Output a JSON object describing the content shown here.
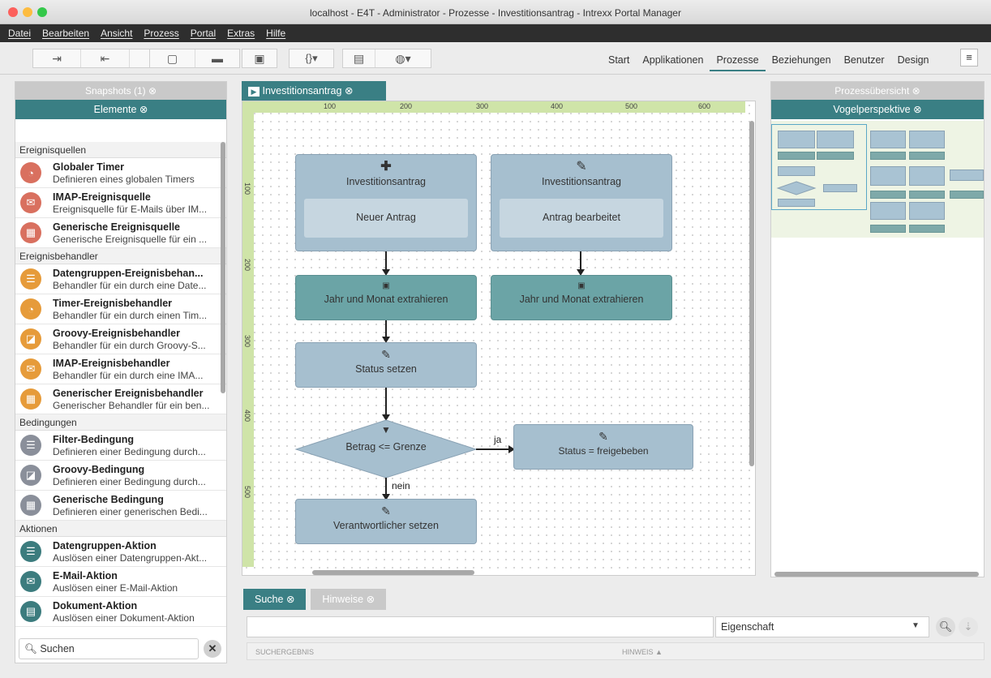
{
  "window": {
    "title": "localhost - E4T - Administrator - Prozesse - Investitionsantrag - Intrexx Portal Manager"
  },
  "menu": [
    "Datei",
    "Bearbeiten",
    "Ansicht",
    "Prozess",
    "Portal",
    "Extras",
    "Hilfe"
  ],
  "toolbar": {
    "nav": [
      "Start",
      "Applikationen",
      "Prozesse",
      "Beziehungen",
      "Benutzer",
      "Design"
    ],
    "active": "Prozesse"
  },
  "left": {
    "snapshots": "Snapshots (1)",
    "elements": "Elemente",
    "categories": [
      {
        "name": "Ereignisquellen",
        "items": [
          {
            "title": "Globaler Timer",
            "desc": "Definieren eines globalen Timers",
            "icon": "timer-icon",
            "color": "red"
          },
          {
            "title": "IMAP-Ereignisquelle",
            "desc": "Ereignisquelle für E-Mails über IM...",
            "icon": "mail-icon",
            "color": "red"
          },
          {
            "title": "Generische Ereignisquelle",
            "desc": "Generische Ereignisquelle für ein ...",
            "icon": "generic-icon",
            "color": "red"
          }
        ]
      },
      {
        "name": "Ereignisbehandler",
        "items": [
          {
            "title": "Datengruppen-Ereignisbehan...",
            "desc": "Behandler für ein durch eine Date...",
            "icon": "database-icon",
            "color": "org"
          },
          {
            "title": "Timer-Ereignisbehandler",
            "desc": "Behandler für ein durch einen Tim...",
            "icon": "timer-icon",
            "color": "org"
          },
          {
            "title": "Groovy-Ereignisbehandler",
            "desc": "Behandler für ein durch Groovy-S...",
            "icon": "groovy-icon",
            "color": "org"
          },
          {
            "title": "IMAP-Ereignisbehandler",
            "desc": "Behandler für ein durch eine IMA...",
            "icon": "mail-icon",
            "color": "org"
          },
          {
            "title": "Generischer Ereignisbehandler",
            "desc": "Generischer Behandler für ein ben...",
            "icon": "generic-icon",
            "color": "org"
          }
        ]
      },
      {
        "name": "Bedingungen",
        "items": [
          {
            "title": "Filter-Bedingung",
            "desc": "Definieren einer Bedingung durch...",
            "icon": "filter-icon",
            "color": "grey"
          },
          {
            "title": "Groovy-Bedingung",
            "desc": "Definieren einer Bedingung durch...",
            "icon": "groovy-icon",
            "color": "grey"
          },
          {
            "title": "Generische Bedingung",
            "desc": "Definieren einer generischen Bedi...",
            "icon": "generic-icon",
            "color": "grey"
          }
        ]
      },
      {
        "name": "Aktionen",
        "items": [
          {
            "title": "Datengruppen-Aktion",
            "desc": "Auslösen einer Datengruppen-Akt...",
            "icon": "database-icon",
            "color": "teal"
          },
          {
            "title": "E-Mail-Aktion",
            "desc": "Auslösen einer E-Mail-Aktion",
            "icon": "mail-icon",
            "color": "teal"
          },
          {
            "title": "Dokument-Aktion",
            "desc": "Auslösen einer Dokument-Aktion",
            "icon": "document-icon",
            "color": "teal"
          }
        ]
      }
    ],
    "search": "Suchen"
  },
  "center": {
    "tab": "Investitionsantrag",
    "ruler_h": [
      "100",
      "200",
      "300",
      "400",
      "500",
      "600"
    ],
    "ruler_v": [
      "100",
      "200",
      "300",
      "400",
      "500"
    ],
    "nodes": {
      "src1_title": "Investitionsantrag",
      "src1_sub": "Neuer Antrag",
      "src2_title": "Investitionsantrag",
      "src2_sub": "Antrag bearbeitet",
      "act1": "Jahr und Monat extrahieren",
      "act2": "Jahr und Monat extrahieren",
      "status": "Status setzen",
      "cond": "Betrag <= Grenze",
      "yes_label": "ja",
      "no_label": "nein",
      "approved": "Status = freigebeben",
      "resp": "Verantwortlicher setzen"
    }
  },
  "right": {
    "overview": "Prozessübersicht",
    "bird": "Vogelperspektive"
  },
  "bottom": {
    "tabs": [
      "Suche",
      "Hinweise"
    ],
    "property": "Eigenschaft",
    "col_result": "SUCHERGEBNIS",
    "col_hint": "HINWEIS"
  }
}
